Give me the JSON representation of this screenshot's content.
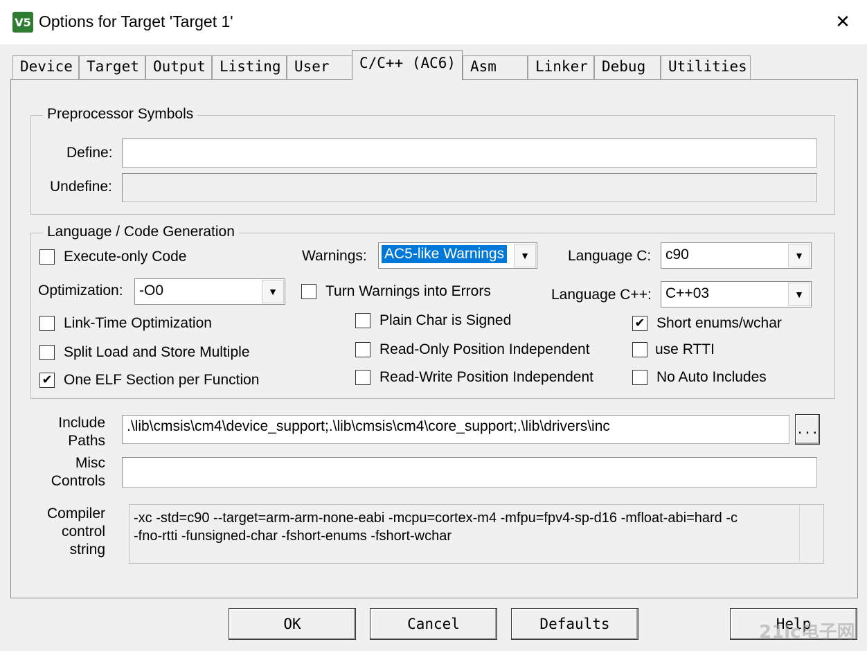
{
  "window": {
    "title": "Options for Target 'Target 1'",
    "icon_text": "V5"
  },
  "tabs": [
    "Device",
    "Target",
    "Output",
    "Listing",
    "User",
    "C/C++ (AC6)",
    "Asm",
    "Linker",
    "Debug",
    "Utilities"
  ],
  "preprocessor": {
    "title": "Preprocessor Symbols",
    "define_label": "Define:",
    "define_value": "",
    "undefine_label": "Undefine:",
    "undefine_value": ""
  },
  "language": {
    "title": "Language / Code Generation",
    "execute_only": {
      "label": "Execute-only Code",
      "checked": false
    },
    "warnings_label": "Warnings:",
    "warnings_value": "AC5-like Warnings",
    "language_c_label": "Language C:",
    "language_c_value": "c90",
    "optimization_label": "Optimization:",
    "optimization_value": "-O0",
    "turn_warnings": {
      "label": "Turn Warnings into Errors",
      "checked": false
    },
    "language_cpp_label": "Language C++:",
    "language_cpp_value": "C++03",
    "lto": {
      "label": "Link-Time Optimization",
      "checked": false
    },
    "plain_char": {
      "label": "Plain Char is Signed",
      "checked": false
    },
    "short_enums": {
      "label": "Short enums/wchar",
      "checked": true
    },
    "split_load": {
      "label": "Split Load and Store Multiple",
      "checked": false
    },
    "ropi": {
      "label": "Read-Only Position Independent",
      "checked": false
    },
    "rtti": {
      "label": "use RTTI",
      "checked": false
    },
    "one_elf": {
      "label": "One ELF Section per Function",
      "checked": true
    },
    "rwpi": {
      "label": "Read-Write Position Independent",
      "checked": false
    },
    "no_auto_includes": {
      "label": "No Auto Includes",
      "checked": false
    }
  },
  "include_paths": {
    "label_line1": "Include",
    "label_line2": "Paths",
    "value": ".\\lib\\cmsis\\cm4\\device_support;.\\lib\\cmsis\\cm4\\core_support;.\\lib\\drivers\\inc",
    "browse_label": "..."
  },
  "misc_controls": {
    "label_line1": "Misc",
    "label_line2": "Controls",
    "value": ""
  },
  "compiler_string": {
    "label_line1": "Compiler",
    "label_line2": "control",
    "label_line3": "string",
    "line1": "-xc -std=c90 --target=arm-arm-none-eabi -mcpu=cortex-m4 -mfpu=fpv4-sp-d16 -mfloat-abi=hard -c",
    "line2": "-fno-rtti -funsigned-char -fshort-enums -fshort-wchar"
  },
  "buttons": {
    "ok": "OK",
    "cancel": "Cancel",
    "defaults": "Defaults",
    "help": "Help"
  },
  "watermark": "21ic电子网"
}
